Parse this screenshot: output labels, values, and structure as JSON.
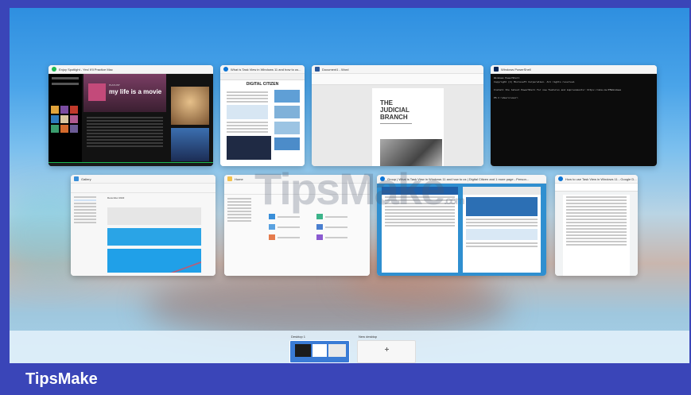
{
  "brand": "TipsMake",
  "watermark": {
    "main": "TipsMake",
    "suffix": ".com"
  },
  "colors": {
    "frame": "#3a45b8",
    "spotify": "#121212",
    "terminal": "#0c0c0c",
    "word_blue": "#2b579a",
    "edge_blue": "#0c74d5"
  },
  "windows": [
    {
      "title": "Enjoy Spotlight - Yes! It'll Practice Mac",
      "app": "spotify",
      "icon": "spotify-icon",
      "content": {
        "album_title": "my life is a movie",
        "playlist_label": "PLAYLIST"
      }
    },
    {
      "title": "What is Task View in Windows 11 and how to us...",
      "app": "edge",
      "icon": "edge-icon",
      "content": {
        "site_logo": "DIGITAL CITIZEN"
      }
    },
    {
      "title": "Document1 - Word",
      "app": "word",
      "icon": "word-icon",
      "content": {
        "doc_title_lines": [
          "THE",
          "JUDICIAL",
          "BRANCH"
        ]
      }
    },
    {
      "title": "Windows PowerShell",
      "app": "powershell",
      "icon": "powershell-icon",
      "content": {
        "lines": [
          "Windows PowerShell",
          "Copyright (C) Microsoft Corporation. All rights reserved.",
          "Install the latest PowerShell for new features and improvements! https://aka.ms/PSWindows",
          "PS C:\\Users\\user>"
        ]
      }
    },
    {
      "title": "Gallery",
      "app": "gallery",
      "icon": "gallery-icon",
      "content": {
        "section": "December 2022"
      }
    },
    {
      "title": "Home",
      "app": "explorer",
      "icon": "folder-icon",
      "content": {}
    },
    {
      "title": "Group | What is Task View in Windows 11 and how to us | Digital Citizen and 1 more page - Person...",
      "app": "edge-group",
      "icon": "edge-icon",
      "content": {}
    },
    {
      "title": "How to use Task View in Windows 11 - Google D...",
      "app": "docs",
      "icon": "docs-icon",
      "content": {}
    }
  ],
  "desktops": [
    {
      "label": "Desktop 1"
    },
    {
      "label": "New desktop"
    }
  ]
}
